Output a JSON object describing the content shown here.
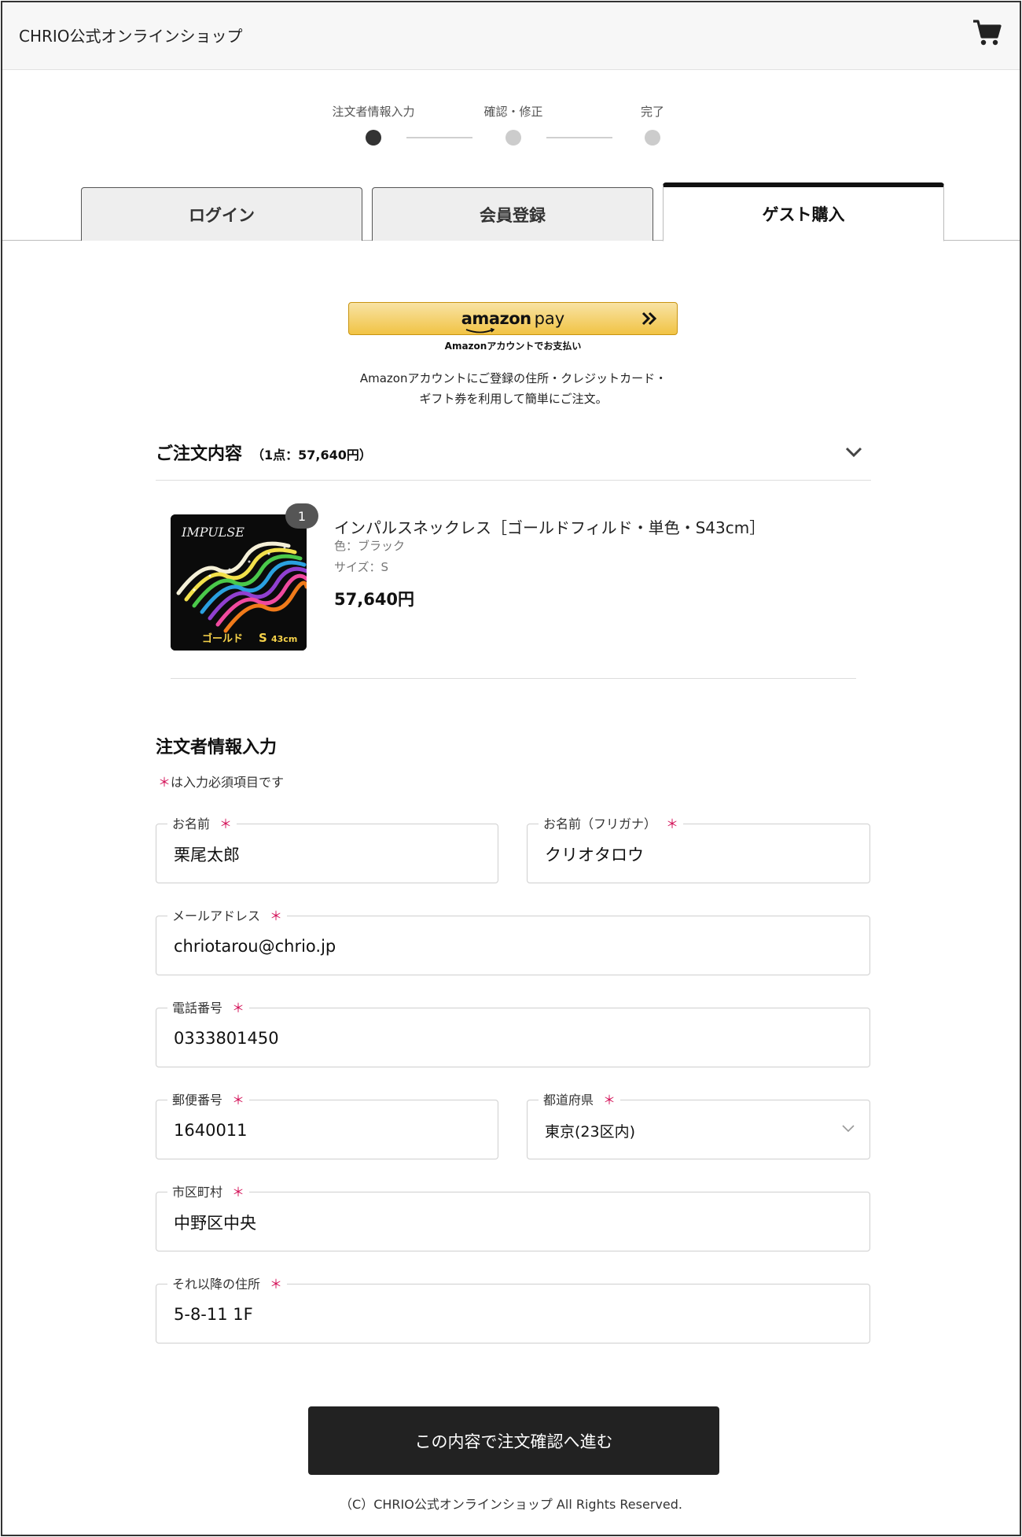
{
  "header": {
    "shop_title": "CHRIO公式オンラインショップ",
    "cart_icon": "cart-icon"
  },
  "steps": [
    {
      "label": "注文者情報入力",
      "active": true
    },
    {
      "label": "確認・修正",
      "active": false
    },
    {
      "label": "完了",
      "active": false
    }
  ],
  "tabs": [
    {
      "label": "ログイン",
      "active": false
    },
    {
      "label": "会員登録",
      "active": false
    },
    {
      "label": "ゲスト購入",
      "active": true
    }
  ],
  "amazon_pay": {
    "logo_amazon": "amazon",
    "logo_pay": "pay",
    "sub_label": "Amazonアカウントでお支払い",
    "description": "Amazonアカウントにご登録の住所・クレジットカード・ギフト券を利用して簡単にご注文。"
  },
  "order_summary": {
    "title": "ご注文内容",
    "count_text": "（1点：57,640円）",
    "product": {
      "quantity_badge": "1",
      "name": "インパルスネックレス［ゴールドフィルド・単色・S43cm］",
      "color": "色：ブラック",
      "size": "サイズ：S",
      "price": "57,640円",
      "image_text": {
        "brand": "IMPULSE",
        "caption_left": "ゴールド",
        "caption_size": "S",
        "caption_length": "43cm"
      }
    }
  },
  "form": {
    "title": "注文者情報入力",
    "required_mark": "＊",
    "required_note": "は入力必須項目です",
    "fields": {
      "name": {
        "label": "お名前",
        "value": "栗尾太郎"
      },
      "kana": {
        "label": "お名前（フリガナ）",
        "value": "クリオタロウ"
      },
      "email": {
        "label": "メールアドレス",
        "value": "chriotarou@chrio.jp"
      },
      "phone": {
        "label": "電話番号",
        "value": "0333801450"
      },
      "zip": {
        "label": "郵便番号",
        "value": "1640011"
      },
      "prefecture": {
        "label": "都道府県",
        "value": "東京(23区内)"
      },
      "city": {
        "label": "市区町村",
        "value": "中野区中央"
      },
      "address": {
        "label": "それ以降の住所",
        "value": "5-8-11 1F"
      }
    }
  },
  "submit_label": "この内容で注文確認へ進む",
  "footer": "（C）CHRIO公式オンラインショップ All Rights Reserved.",
  "colors": {
    "accent_dark": "#222222",
    "required": "#d4145a",
    "amazon_yellow": "#f1c344"
  }
}
